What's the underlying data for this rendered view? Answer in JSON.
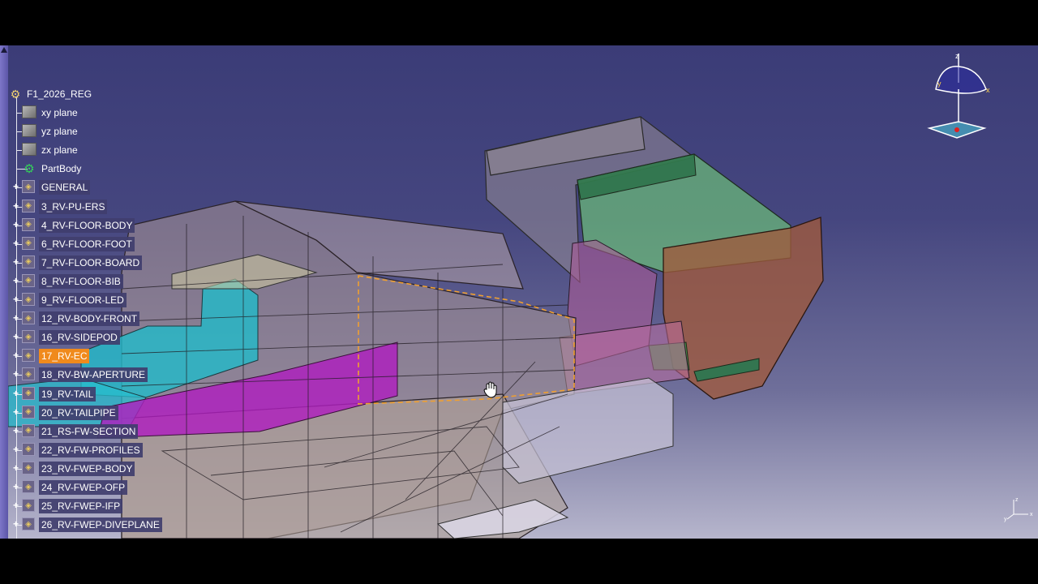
{
  "tree": {
    "root": "F1_2026_REG",
    "nodes": [
      {
        "label": "xy plane",
        "icon": "plane-icon",
        "expandable": false
      },
      {
        "label": "yz plane",
        "icon": "plane-icon",
        "expandable": false
      },
      {
        "label": "zx plane",
        "icon": "plane-icon",
        "expandable": false
      },
      {
        "label": "PartBody",
        "icon": "partbody-gear-icon",
        "expandable": false
      },
      {
        "label": "GENERAL",
        "icon": "geometrical-set-icon",
        "expandable": true
      },
      {
        "label": "3_RV-PU-ERS",
        "icon": "geometrical-set-icon",
        "expandable": true
      },
      {
        "label": "4_RV-FLOOR-BODY",
        "icon": "geometrical-set-icon",
        "expandable": true
      },
      {
        "label": "6_RV-FLOOR-FOOT",
        "icon": "geometrical-set-icon",
        "expandable": true
      },
      {
        "label": "7_RV-FLOOR-BOARD",
        "icon": "geometrical-set-icon",
        "expandable": true
      },
      {
        "label": "8_RV-FLOOR-BIB",
        "icon": "geometrical-set-icon",
        "expandable": true
      },
      {
        "label": "9_RV-FLOOR-LED",
        "icon": "geometrical-set-icon",
        "expandable": true
      },
      {
        "label": "12_RV-BODY-FRONT",
        "icon": "geometrical-set-icon",
        "expandable": true
      },
      {
        "label": "16_RV-SIDEPOD",
        "icon": "geometrical-set-icon",
        "expandable": true
      },
      {
        "label": "17_RV-EC",
        "icon": "geometrical-set-icon",
        "expandable": true,
        "selected": true
      },
      {
        "label": "18_RV-BW-APERTURE",
        "icon": "geometrical-set-icon",
        "expandable": true
      },
      {
        "label": "19_RV-TAIL",
        "icon": "geometrical-set-icon",
        "expandable": true
      },
      {
        "label": "20_RV-TAILPIPE",
        "icon": "geometrical-set-icon",
        "expandable": true
      },
      {
        "label": "21_RS-FW-SECTION",
        "icon": "geometrical-set-icon",
        "expandable": true
      },
      {
        "label": "22_RV-FW-PROFILES",
        "icon": "geometrical-set-icon",
        "expandable": true
      },
      {
        "label": "23_RV-FWEP-BODY",
        "icon": "geometrical-set-icon",
        "expandable": true
      },
      {
        "label": "24_RV-FWEP-OFP",
        "icon": "geometrical-set-icon",
        "expandable": true
      },
      {
        "label": "25_RV-FWEP-IFP",
        "icon": "geometrical-set-icon",
        "expandable": true
      },
      {
        "label": "26_RV-FWEP-DIVEPLANE",
        "icon": "geometrical-set-icon",
        "expandable": true
      }
    ]
  },
  "compass": {
    "x": "x",
    "y": "y",
    "z": "z"
  },
  "colors": {
    "selection": "#f08a1c",
    "cyan_surface": "#25b6c4",
    "magenta_surface": "#b01ec0",
    "green_surface": "#5fbf6a",
    "brown_surface": "#9a5a3e"
  }
}
